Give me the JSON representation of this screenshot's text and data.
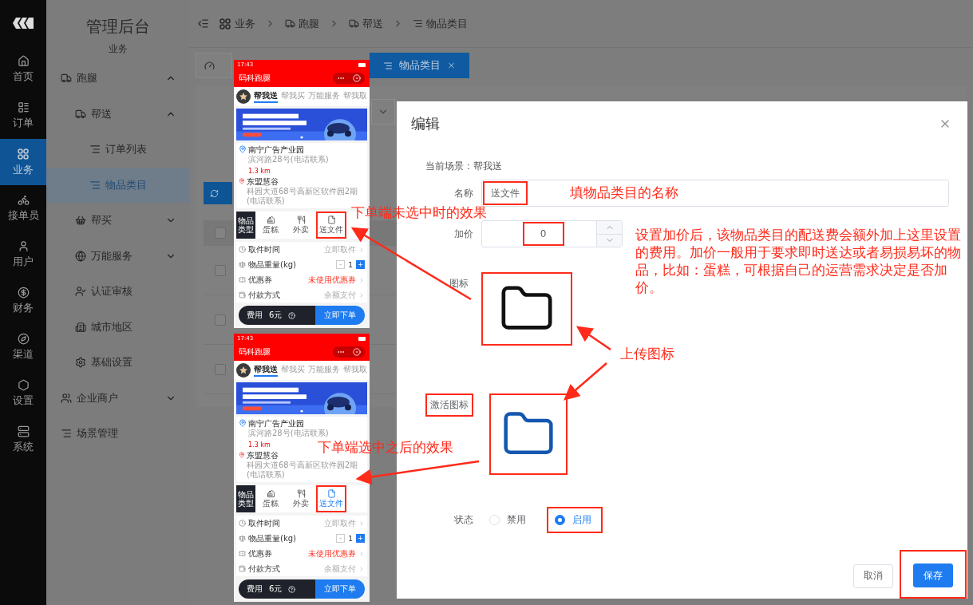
{
  "nav": {
    "items": [
      {
        "label": "首页",
        "selected": false
      },
      {
        "label": "订单",
        "selected": false
      },
      {
        "label": "业务",
        "selected": true
      },
      {
        "label": "接单员",
        "selected": false
      },
      {
        "label": "用户",
        "selected": false
      },
      {
        "label": "财务",
        "selected": false
      },
      {
        "label": "渠道",
        "selected": false
      },
      {
        "label": "设置",
        "selected": false
      },
      {
        "label": "系统",
        "selected": false
      }
    ]
  },
  "sidebar": {
    "title": "管理后台",
    "subtitle": "业务",
    "items": [
      {
        "label": "跑腿",
        "expanded": true,
        "children": [
          {
            "label": "帮送",
            "expanded": true,
            "children": [
              {
                "label": "订单列表",
                "selected": false
              },
              {
                "label": "物品类目",
                "selected": true
              }
            ]
          },
          {
            "label": "帮买",
            "expanded": false
          },
          {
            "label": "万能服务",
            "expanded": false
          },
          {
            "label": "认证审核"
          },
          {
            "label": "城市地区"
          },
          {
            "label": "基础设置"
          }
        ]
      },
      {
        "label": "企业商户",
        "expanded": false
      },
      {
        "label": "场景管理"
      }
    ]
  },
  "breadcrumb": [
    "业务",
    "跑腿",
    "帮送",
    "物品类目"
  ],
  "tabs": [
    {
      "selected": false
    },
    {
      "label": "物品类目",
      "selected": true
    }
  ],
  "table": {
    "rows": [
      {
        "checked": false
      },
      {
        "checked": false
      },
      {
        "checked": false
      },
      {
        "checked": false
      }
    ]
  },
  "phones": [
    {
      "time": "17:43",
      "app_title": "码科跑腿",
      "tabs": [
        {
          "label": "帮我送",
          "selected": true
        },
        {
          "label": "帮我买",
          "selected": false
        },
        {
          "label": "万能服务",
          "selected": false
        },
        {
          "label": "帮我取",
          "selected": false
        }
      ],
      "from": {
        "name": "南宁广告产业园",
        "detail": "滨河路28号(电话联系)"
      },
      "distance": "1.3 km",
      "to": {
        "name": "东盟慧谷",
        "detail": "科园大道68号高新区软件园2期(电话联系)"
      },
      "category_label": "物品类型",
      "categories": [
        {
          "label": "蛋糕",
          "selected": false,
          "framed": false
        },
        {
          "label": "外卖",
          "selected": false,
          "framed": false
        },
        {
          "label": "送文件",
          "selected": false,
          "framed": true
        }
      ],
      "rows": [
        {
          "kind": "link",
          "label": "取件时间",
          "value": "立即取件",
          "highlight": false
        },
        {
          "kind": "stepper",
          "label": "物品重量(kg)",
          "value": "1",
          "minus": "-",
          "plus": "+"
        },
        {
          "kind": "link",
          "label": "优惠券",
          "value": "未使用优惠券",
          "highlight": true
        },
        {
          "kind": "link",
          "label": "付款方式",
          "value": "余额支付",
          "highlight": false
        }
      ],
      "fee_label": "费用",
      "fee": "6元",
      "submit": "立即下单"
    },
    {
      "time": "17:43",
      "app_title": "码科跑腿",
      "tabs": [
        {
          "label": "帮我送",
          "selected": true
        },
        {
          "label": "帮我买",
          "selected": false
        },
        {
          "label": "万能服务",
          "selected": false
        },
        {
          "label": "帮我取",
          "selected": false
        }
      ],
      "from": {
        "name": "南宁广告产业园",
        "detail": "滨河路28号(电话联系)"
      },
      "distance": "1.3 km",
      "to": {
        "name": "东盟慧谷",
        "detail": "科园大道68号高新区软件园2期(电话联系)"
      },
      "category_label": "物品类型",
      "categories": [
        {
          "label": "蛋糕",
          "selected": false,
          "framed": false
        },
        {
          "label": "外卖",
          "selected": false,
          "framed": false
        },
        {
          "label": "送文件",
          "selected": true,
          "framed": true
        }
      ],
      "rows": [
        {
          "kind": "link",
          "label": "取件时间",
          "value": "立即取件",
          "highlight": false
        },
        {
          "kind": "stepper",
          "label": "物品重量(kg)",
          "value": "1",
          "minus": "-",
          "plus": "+"
        },
        {
          "kind": "link",
          "label": "优惠券",
          "value": "未使用优惠券",
          "highlight": true
        },
        {
          "kind": "link",
          "label": "付款方式",
          "value": "余额支付",
          "highlight": false
        }
      ],
      "fee_label": "费用",
      "fee": "6元",
      "submit": "立即下单"
    }
  ],
  "dialog": {
    "title": "编辑",
    "scene": "当前场景：帮我送",
    "fields": [
      {
        "kind": "text",
        "label": "名称",
        "value": "送文件",
        "framed": true
      },
      {
        "kind": "number",
        "label": "加价",
        "value": "0",
        "framed": true
      },
      {
        "kind": "upload",
        "label": "图标",
        "active": false,
        "framed": true,
        "label_framed": false
      },
      {
        "kind": "upload",
        "label": "激活图标",
        "active": true,
        "framed": true,
        "label_framed": true
      },
      {
        "kind": "radio",
        "label": "状态",
        "options": [
          {
            "label": "禁用",
            "selected": false,
            "framed": false
          },
          {
            "label": "启用",
            "selected": true,
            "framed": true
          }
        ]
      }
    ],
    "buttons": [
      {
        "label": "取消",
        "kind": "default",
        "framed": false
      },
      {
        "label": "保存",
        "kind": "primary",
        "framed": true
      }
    ]
  },
  "annotations": [
    "下单端未选中时的效果",
    "填物品类目的名称",
    "设置加价后，该物品类目的配送费会额外加上这里设置的费用。加价一般用于要求即时送达或者易损易坏的物品，比如：蛋糕，可根据自己的运营需求决定是否加价。",
    "上传图标",
    "下单端选中之后的效果"
  ]
}
